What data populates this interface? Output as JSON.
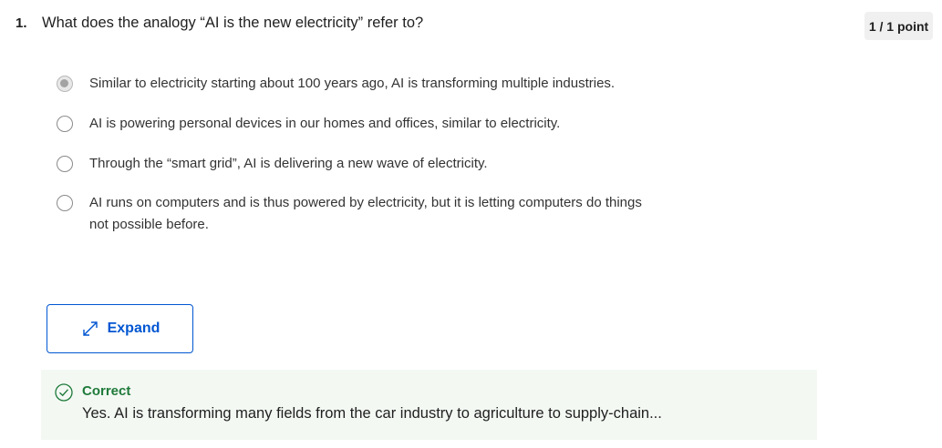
{
  "question": {
    "number": "1.",
    "text": "What does the analogy “AI is the new electricity” refer to?",
    "points": "1 / 1 point"
  },
  "options": [
    {
      "label": "Similar to electricity starting about 100 years ago, AI is transforming multiple industries.",
      "selected": true
    },
    {
      "label": "AI is powering personal devices in our homes and offices, similar to electricity.",
      "selected": false
    },
    {
      "label": "Through the “smart grid”, AI is delivering a new wave of electricity.",
      "selected": false
    },
    {
      "label": "AI runs on computers and is thus powered by electricity, but it is letting computers do things not possible before.",
      "selected": false
    }
  ],
  "expand": {
    "label": "Expand",
    "icon": "expand-arrows-icon"
  },
  "feedback": {
    "title": "Correct",
    "text": "Yes. AI is transforming many fields from the car industry to agriculture to supply-chain...",
    "icon": "check-circle-icon"
  },
  "colors": {
    "accent": "#0056d2",
    "correct": "#1f7a3a",
    "feedback_bg": "#f3f8f3",
    "badge_bg": "#f0f0f0"
  }
}
